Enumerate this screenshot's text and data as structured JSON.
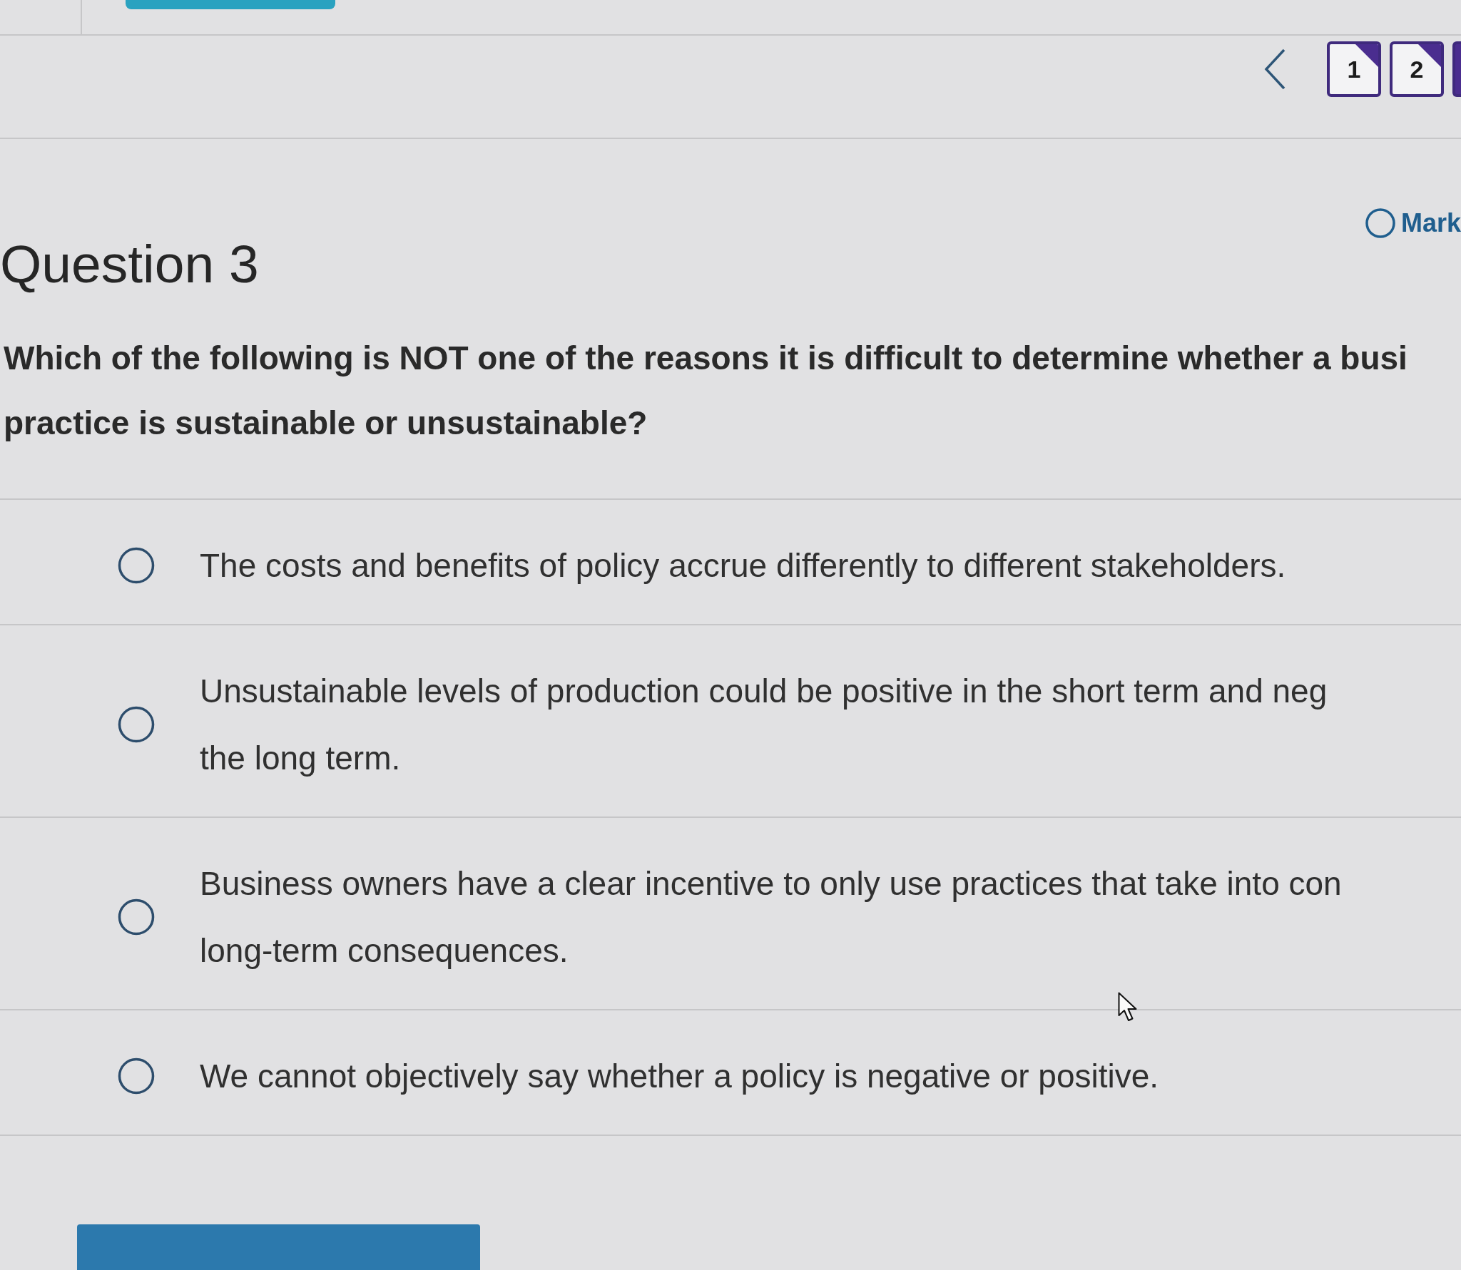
{
  "navigation": {
    "pages": [
      {
        "label": "1",
        "answered": true,
        "selected": false
      },
      {
        "label": "2",
        "answered": true,
        "selected": false
      },
      {
        "selected": true
      }
    ]
  },
  "mark": {
    "label": "Mark",
    "checked": false
  },
  "question": {
    "heading": "Question 3",
    "lines": [
      "Which of the following is NOT one of the reasons it is difficult to determine whether a busi",
      "practice is sustainable or unsustainable?"
    ]
  },
  "options": [
    {
      "lines": [
        "The costs and benefits of policy accrue differently to different stakeholders."
      ],
      "selected": false
    },
    {
      "lines": [
        "Unsustainable levels of production could be positive in the short term and neg",
        "the long term."
      ],
      "selected": false
    },
    {
      "lines": [
        "Business owners have a clear incentive to only use practices that take into con",
        "long-term consequences."
      ],
      "selected": false
    },
    {
      "lines": [
        "We cannot objectively say whether a policy is negative or positive."
      ],
      "selected": false
    }
  ]
}
